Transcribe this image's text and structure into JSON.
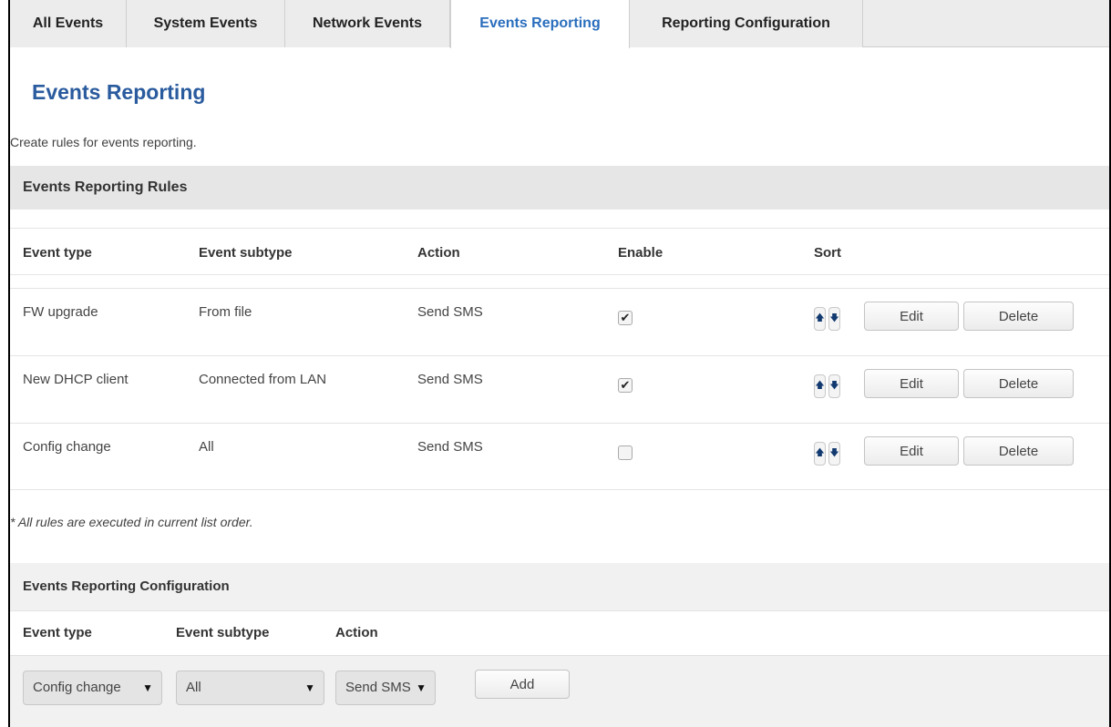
{
  "tabs": [
    {
      "label": "All Events"
    },
    {
      "label": "System Events"
    },
    {
      "label": "Network Events"
    },
    {
      "label": "Events Reporting",
      "active": true
    },
    {
      "label": "Reporting Configuration"
    }
  ],
  "page": {
    "title": "Events Reporting",
    "description": "Create rules for events reporting."
  },
  "rules": {
    "section_title": "Events Reporting Rules",
    "columns": [
      "Event type",
      "Event subtype",
      "Action",
      "Enable",
      "Sort"
    ],
    "rows": [
      {
        "event_type": "FW upgrade",
        "event_subtype": "From file",
        "action": "Send SMS",
        "enabled": true
      },
      {
        "event_type": "New DHCP client",
        "event_subtype": "Connected from LAN",
        "action": "Send SMS",
        "enabled": true
      },
      {
        "event_type": "Config change",
        "event_subtype": "All",
        "action": "Send SMS",
        "enabled": false
      }
    ],
    "edit_label": "Edit",
    "delete_label": "Delete",
    "sort_up_glyph": "🡅",
    "sort_down_glyph": "🡇",
    "note": "* All rules are executed in current list order."
  },
  "config": {
    "section_title": "Events Reporting Configuration",
    "columns": [
      "Event type",
      "Event subtype",
      "Action"
    ],
    "event_type_value": "Config change",
    "event_subtype_value": "All",
    "action_value": "Send SMS",
    "add_label": "Add",
    "dropdown_glyph": "▼"
  },
  "icons": {
    "checkmark": "✔",
    "sort_up": "arrow-up-icon",
    "sort_down": "arrow-down-icon"
  },
  "colors": {
    "accent_blue": "#2a6ebd",
    "title_blue": "#2a5b9e",
    "tab_bg": "#ececec",
    "section_bg": "#e6e6e6"
  }
}
